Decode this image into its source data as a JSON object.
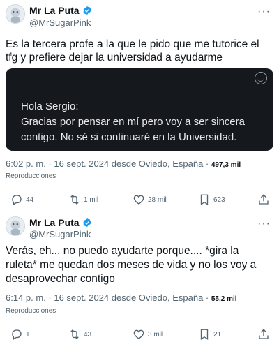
{
  "posts": [
    {
      "display_name": "Mr La Puta",
      "handle": "@MrSugarPink",
      "text": "Es la tercera profe a la que le pido que me tutorice el tfg y prefiere dejar la universidad a ayudarme",
      "media": {
        "greeting": "Hola Sergio:",
        "body": "Gracias por pensar en mí pero voy a ser sincera contigo. No sé si continuaré en la Universidad."
      },
      "timestamp": "6:02 p. m. · 16 sept. 2024 desde Oviedo, España ·",
      "views": "497,3 mil",
      "views_label": "Reproducciones",
      "actions": {
        "replies": "44",
        "reposts": "1 mil",
        "likes": "28 mil",
        "bookmarks": "623"
      }
    },
    {
      "display_name": "Mr La Puta",
      "handle": "@MrSugarPink",
      "text": "Verás, eh... no puedo ayudarte porque.... *gira la ruleta* me quedan dos meses de vida y no los voy a desaprovechar contigo",
      "timestamp": "6:14 p. m. · 16 sept. 2024 desde Oviedo, España ·",
      "views": "55,2 mil",
      "views_label": "Reproducciones",
      "actions": {
        "replies": "1",
        "reposts": "43",
        "likes": "3 mil",
        "bookmarks": "21"
      }
    }
  ],
  "icons": {
    "verified": "verified-badge-icon",
    "more": "more-options-icon",
    "reply": "reply-icon",
    "repost": "repost-icon",
    "like": "heart-icon",
    "bookmark": "bookmark-icon",
    "share": "share-icon"
  },
  "colors": {
    "verified": "#1d9bf0",
    "text": "#0f1419",
    "secondary": "#536471",
    "media_bg": "#15181c"
  }
}
